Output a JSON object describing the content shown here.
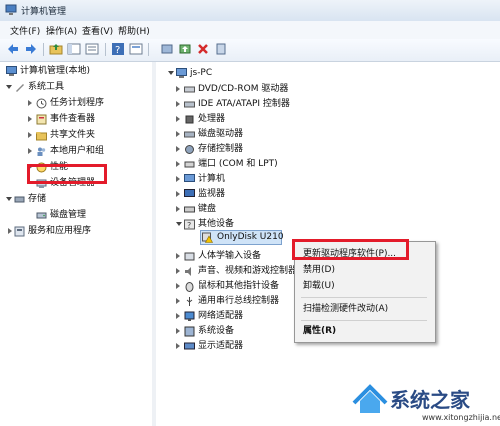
{
  "window": {
    "title": "计算机管理"
  },
  "menu": [
    "文件(F)",
    "操作(A)",
    "查看(V)",
    "帮助(H)"
  ],
  "left_tree": {
    "root": "计算机管理(本地)",
    "system_tools": "系统工具",
    "items": [
      "任务计划程序",
      "事件查看器",
      "共享文件夹",
      "本地用户和组",
      "性能",
      "设备管理器"
    ],
    "storage": "存储",
    "disk_management": "磁盘管理",
    "services": "服务和应用程序"
  },
  "device_tree": {
    "root": "js-PC",
    "items_before": [
      "DVD/CD-ROM 驱动器",
      "IDE ATA/ATAPI 控制器",
      "处理器",
      "磁盘驱动器",
      "存储控制器",
      "端口 (COM 和 LPT)",
      "计算机",
      "监视器",
      "键盘",
      "其他设备"
    ],
    "selected_device": "OnlyDisk U210",
    "items_after": [
      "人体学输入设备",
      "声音、视频和游戏控制器",
      "鼠标和其他指针设备",
      "通用串行总线控制器",
      "网络适配器",
      "系统设备",
      "显示适配器"
    ]
  },
  "context_menu": {
    "update_driver": "更新驱动程序软件(P)...",
    "disable": "禁用(D)",
    "uninstall": "卸载(U)",
    "scan": "扫描检测硬件改动(A)",
    "properties": "属性(R)"
  },
  "watermark": {
    "text": "系统之家",
    "url": "www.xitongzhijia.net"
  },
  "colors": {
    "highlight_box": "#e31b2a",
    "selection": "#cfe3f7"
  }
}
